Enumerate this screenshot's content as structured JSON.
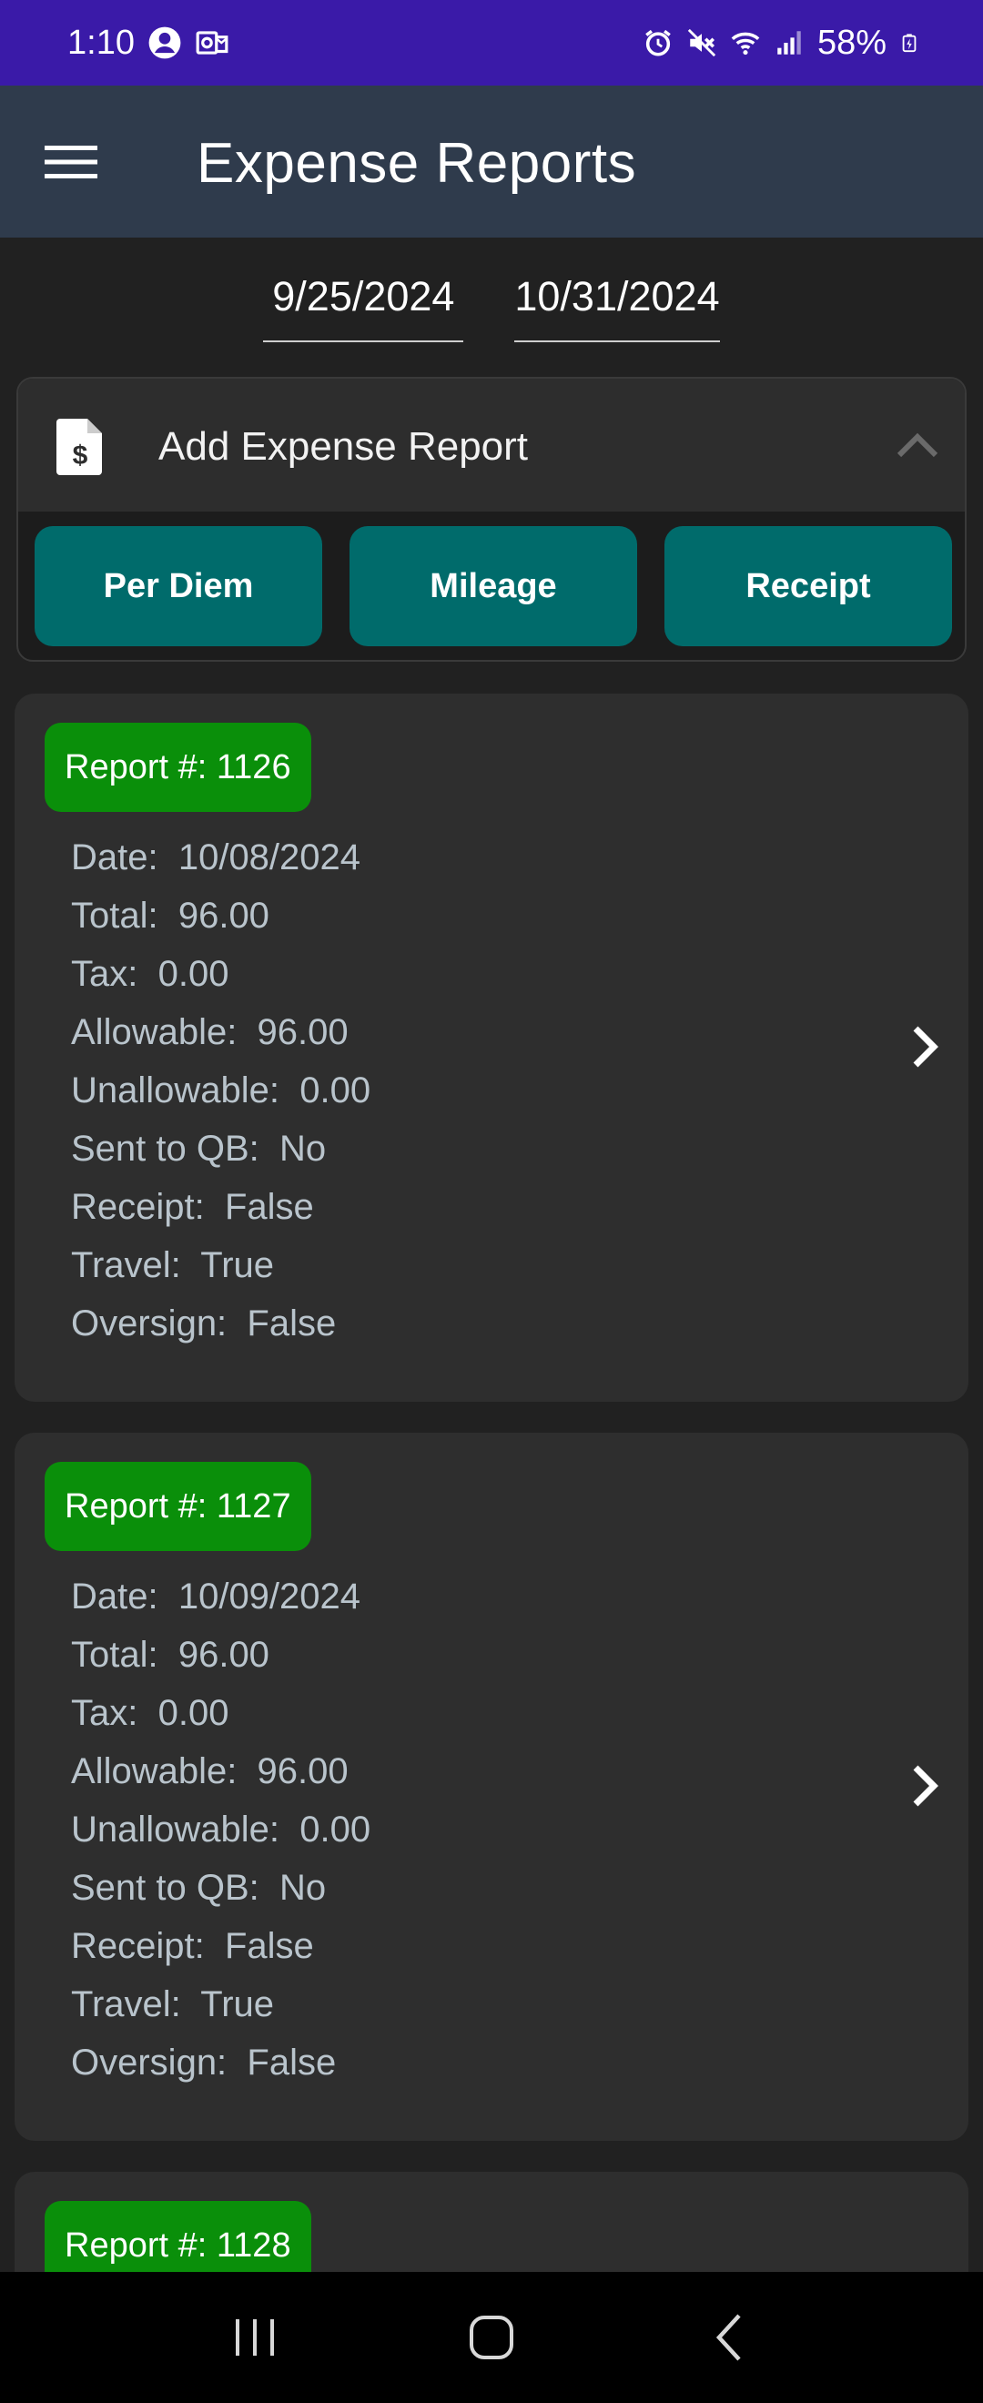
{
  "status_bar": {
    "time": "1:10",
    "battery": "58%",
    "icons": [
      "account-circle-icon",
      "outlook-icon",
      "alarm-icon",
      "mute-icon",
      "wifi-icon",
      "signal-icon",
      "battery-icon"
    ]
  },
  "app_bar": {
    "title": "Expense Reports",
    "menu_icon": "hamburger-menu-icon"
  },
  "date_range": {
    "start": "9/25/2024",
    "end": "10/31/2024"
  },
  "add_panel": {
    "title": "Add Expense Report",
    "icon": "receipt-dollar-icon",
    "expanded": true,
    "buttons": [
      "Per Diem",
      "Mileage",
      "Receipt"
    ]
  },
  "reports": [
    {
      "badge": "Report #:  1126",
      "lines": [
        "Date:  10/08/2024",
        "Total:  96.00",
        "Tax:  0.00",
        "Allowable:  96.00",
        "Unallowable:  0.00",
        "Sent to QB:  No",
        "Receipt:  False",
        "Travel:  True",
        "Oversign:  False"
      ]
    },
    {
      "badge": "Report #:  1127",
      "lines": [
        "Date:  10/09/2024",
        "Total:  96.00",
        "Tax:  0.00",
        "Allowable:  96.00",
        "Unallowable:  0.00",
        "Sent to QB:  No",
        "Receipt:  False",
        "Travel:  True",
        "Oversign:  False"
      ]
    },
    {
      "badge": "Report #:  1128",
      "lines": []
    }
  ],
  "colors": {
    "status_bar": "#3a1aa8",
    "app_bar": "#2f3b4c",
    "background": "#212121",
    "card": "#2e2e2e",
    "badge": "#0a8f0a",
    "button": "#006b6b",
    "detail_text": "#b9c4cc"
  },
  "nav_bar": {
    "buttons": [
      "recents-icon",
      "home-icon",
      "back-icon"
    ]
  }
}
